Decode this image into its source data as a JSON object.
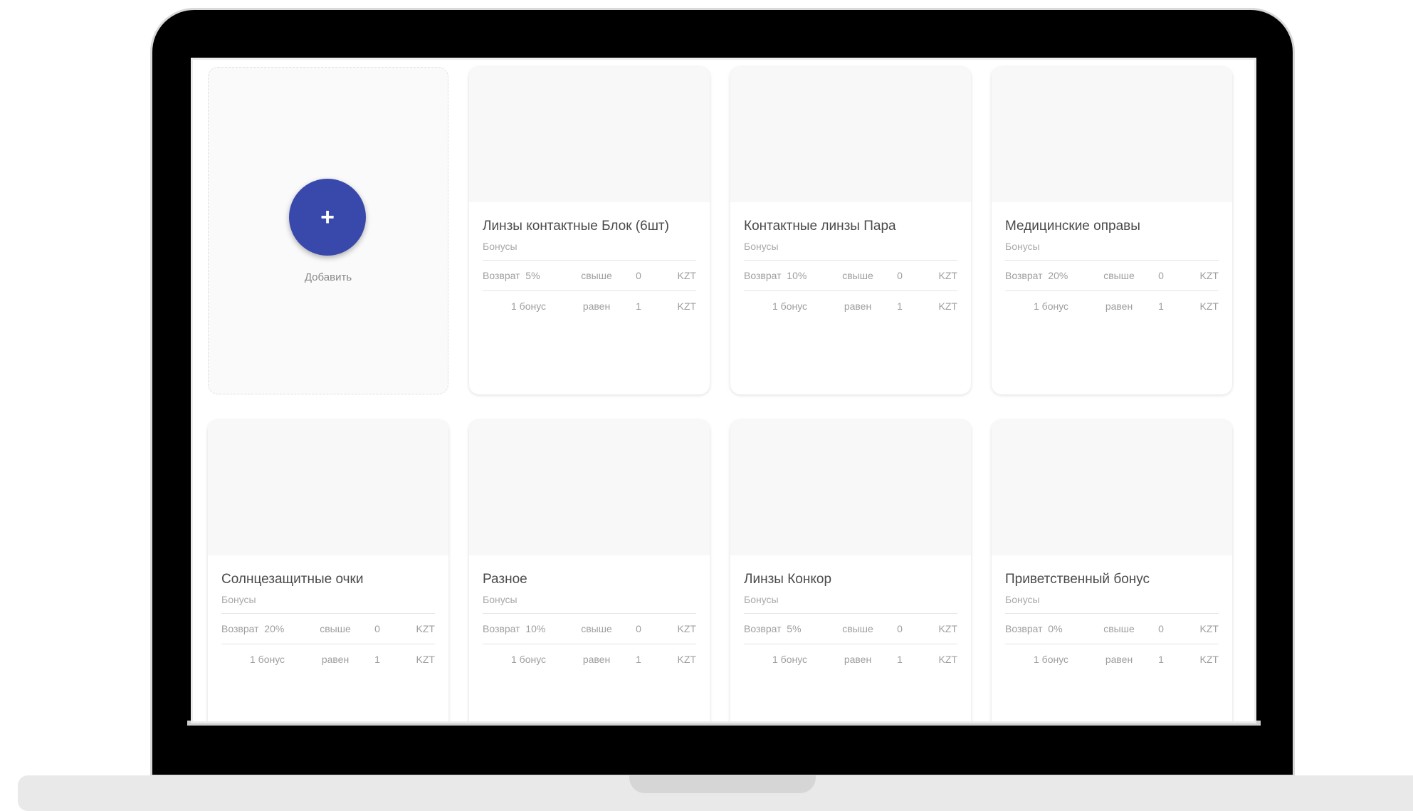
{
  "add_card": {
    "icon": "plus-icon",
    "plus_glyph": "+",
    "label": "Добавить"
  },
  "cards": [
    {
      "title": "Линзы контактные Блок (6шт)",
      "subtitle": "Бонусы",
      "return_label": "Возврат",
      "return_percent": "5%",
      "above_label": "свыше",
      "above_value": "0",
      "currency": "KZT",
      "rate_label": "1 бонус",
      "equals_label": "равен",
      "rate_value": "1",
      "rate_currency": "KZT"
    },
    {
      "title": "Контактные линзы Пара",
      "subtitle": "Бонусы",
      "return_label": "Возврат",
      "return_percent": "10%",
      "above_label": "свыше",
      "above_value": "0",
      "currency": "KZT",
      "rate_label": "1 бонус",
      "equals_label": "равен",
      "rate_value": "1",
      "rate_currency": "KZT"
    },
    {
      "title": "Медицинские оправы",
      "subtitle": "Бонусы",
      "return_label": "Возврат",
      "return_percent": "20%",
      "above_label": "свыше",
      "above_value": "0",
      "currency": "KZT",
      "rate_label": "1 бонус",
      "equals_label": "равен",
      "rate_value": "1",
      "rate_currency": "KZT"
    },
    {
      "title": "Солнцезащитные очки",
      "subtitle": "Бонусы",
      "return_label": "Возврат",
      "return_percent": "20%",
      "above_label": "свыше",
      "above_value": "0",
      "currency": "KZT",
      "rate_label": "1 бонус",
      "equals_label": "равен",
      "rate_value": "1",
      "rate_currency": "KZT"
    },
    {
      "title": "Разное",
      "subtitle": "Бонусы",
      "return_label": "Возврат",
      "return_percent": "10%",
      "above_label": "свыше",
      "above_value": "0",
      "currency": "KZT",
      "rate_label": "1 бонус",
      "equals_label": "равен",
      "rate_value": "1",
      "rate_currency": "KZT"
    },
    {
      "title": "Линзы Конкор",
      "subtitle": "Бонусы",
      "return_label": "Возврат",
      "return_percent": "5%",
      "above_label": "свыше",
      "above_value": "0",
      "currency": "KZT",
      "rate_label": "1 бонус",
      "equals_label": "равен",
      "rate_value": "1",
      "rate_currency": "KZT"
    },
    {
      "title": "Приветственный бонус",
      "subtitle": "Бонусы",
      "return_label": "Возврат",
      "return_percent": "0%",
      "above_label": "свыше",
      "above_value": "0",
      "currency": "KZT",
      "rate_label": "1 бонус",
      "equals_label": "равен",
      "rate_value": "1",
      "rate_currency": "KZT"
    }
  ],
  "colors": {
    "accent": "#3949ab",
    "frame": "#000000",
    "base": "#e9e9e9"
  }
}
